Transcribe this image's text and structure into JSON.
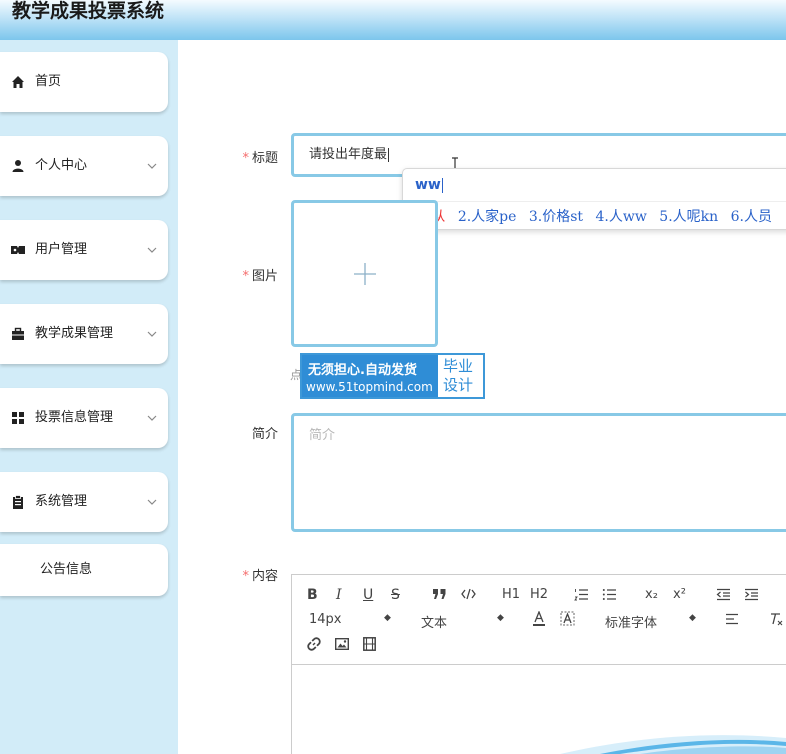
{
  "app": {
    "title": "教学成果投票系统"
  },
  "sidebar": {
    "items": [
      {
        "label": "首页",
        "icon": "home-icon",
        "expandable": false
      },
      {
        "label": "个人中心",
        "icon": "user-icon",
        "expandable": true
      },
      {
        "label": "用户管理",
        "icon": "ticket-icon",
        "expandable": true
      },
      {
        "label": "教学成果管理",
        "icon": "briefcase-icon",
        "expandable": true
      },
      {
        "label": "投票信息管理",
        "icon": "grid-icon",
        "expandable": true
      },
      {
        "label": "系统管理",
        "icon": "clipboard-icon",
        "expandable": true
      },
      {
        "label": "公告信息",
        "icon": "",
        "expandable": false
      }
    ]
  },
  "form": {
    "title": {
      "label": "标题",
      "required": true,
      "value": "请投出年度最"
    },
    "image": {
      "label": "图片",
      "required": true,
      "tip": "点"
    },
    "intro": {
      "label": "简介",
      "required": false,
      "placeholder": "简介"
    },
    "content": {
      "label": "内容",
      "required": true
    }
  },
  "ime": {
    "composition": "ww",
    "candidates": [
      "1.从",
      "2.人家pe",
      "3.价格st",
      "4.人ww",
      "5.人呢kn",
      "6.人员"
    ]
  },
  "watermark": {
    "line1": "无须担心.自动发货",
    "line2": "www.51topmind.com",
    "side1": "毕业",
    "side2": "设计"
  },
  "editor": {
    "font_size": "14px",
    "header_select": "文本",
    "font_select": "标准字体",
    "buttons": [
      "B",
      "I",
      "U",
      "S",
      "H1",
      "H2",
      "x₂",
      "x²"
    ]
  },
  "colors": {
    "accent_border": "#88c9e6",
    "sidebar_bg": "#d2ecf8",
    "required": "#f56c6c",
    "ime_blue": "#2a62c9",
    "watermark_blue": "#2f8dd6"
  }
}
